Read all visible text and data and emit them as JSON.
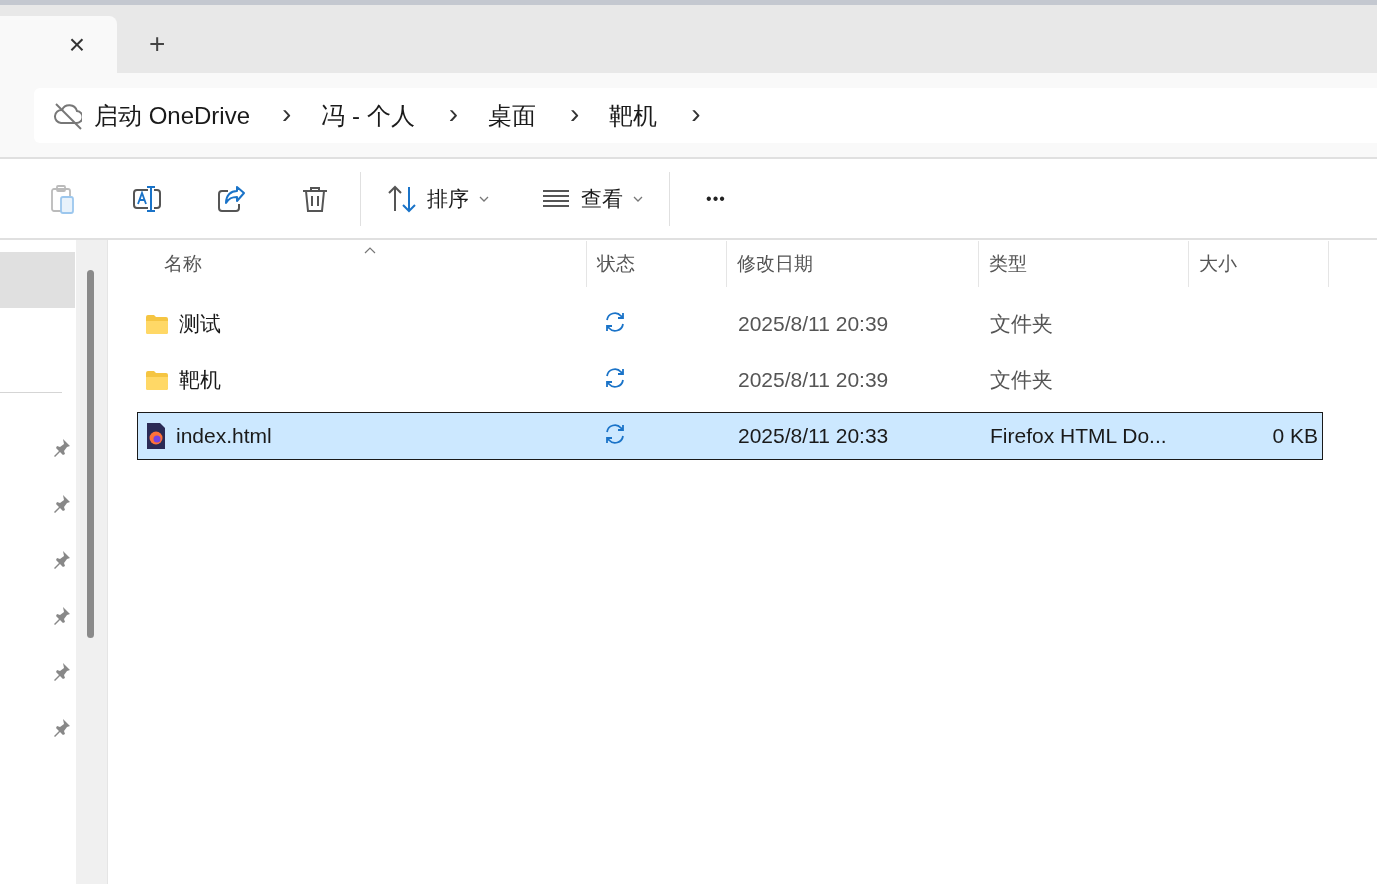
{
  "tabs": {
    "active_tab": {
      "selected": true
    },
    "close": "×",
    "new_tab": "+"
  },
  "address": {
    "offline": true,
    "segments": [
      "启动 OneDrive",
      "冯 - 个人",
      "桌面",
      "靶机"
    ],
    "separator": "›"
  },
  "toolbar": {
    "actions": [
      {
        "kind": "paste",
        "disabled": true
      },
      {
        "kind": "rename",
        "disabled": false
      },
      {
        "kind": "share",
        "disabled": false
      },
      {
        "kind": "delete",
        "disabled": false
      }
    ],
    "menus": [
      {
        "kind": "sort",
        "label": "排序"
      },
      {
        "kind": "view",
        "label": "查看"
      }
    ],
    "more": "•••"
  },
  "sidebar": {
    "items": [
      {
        "selected": true,
        "pinned": false
      },
      {
        "selected": false,
        "pinned": true
      },
      {
        "selected": false,
        "pinned": true
      },
      {
        "selected": false,
        "pinned": true
      },
      {
        "selected": false,
        "pinned": true
      },
      {
        "selected": false,
        "pinned": true
      },
      {
        "selected": false,
        "pinned": true
      }
    ]
  },
  "table": {
    "columns": [
      {
        "label": "名称",
        "sorted": true
      },
      {
        "label": "状态",
        "sorted": false
      },
      {
        "label": "修改日期",
        "sorted": false
      },
      {
        "label": "类型",
        "sorted": false
      },
      {
        "label": "大小",
        "sorted": false
      }
    ],
    "rows": [
      {
        "kind": "folder",
        "name": "测试",
        "syncing": true,
        "date": "2025/8/11 20:39",
        "type": "文件夹",
        "selected": false
      },
      {
        "kind": "folder",
        "name": "靶机",
        "syncing": true,
        "date": "2025/8/11 20:39",
        "type": "文件夹",
        "selected": false
      },
      {
        "kind": "html",
        "name": "index.html",
        "syncing": true,
        "date": "2025/8/11 20:33",
        "type": "Firefox HTML Do...",
        "size": "0 KB",
        "selected": true
      }
    ]
  }
}
